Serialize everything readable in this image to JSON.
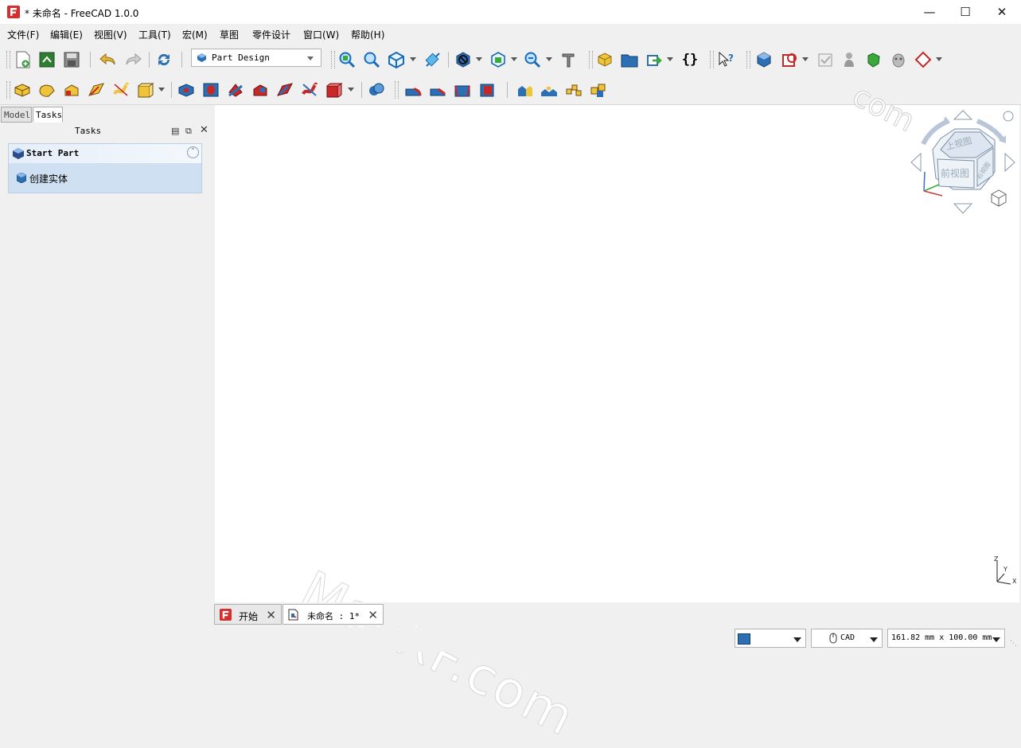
{
  "window": {
    "title": "* 未命名 - FreeCAD 1.0.0"
  },
  "menu": [
    "文件(F)",
    "编辑(E)",
    "视图(V)",
    "工具(T)",
    "宏(M)",
    "草图",
    "零件设计",
    "窗口(W)",
    "帮助(H)"
  ],
  "toolbar1": {
    "workbench": "Part Design",
    "icons": [
      "new-document-icon",
      "open-icon",
      "save-icon",
      "undo-icon",
      "redo-icon",
      "refresh-icon",
      "fit-all-icon",
      "fit-selection-icon",
      "isometric-view-icon",
      "measure-icon",
      "draw-style-icon",
      "bounding-box-icon",
      "zoom-icon",
      "measure-tool-icon",
      "create-part-icon",
      "create-group-icon",
      "link-icon",
      "variable-set-icon",
      "whats-this-icon",
      "body-icon",
      "sketch-icon",
      "check-geometry-icon",
      "attach-icon",
      "shape-binder-icon",
      "sub-shape-binder-icon",
      "datum-icon"
    ]
  },
  "toolbar2": {
    "icons": [
      "pad-icon",
      "revolution-icon",
      "additive-loft-icon",
      "additive-pipe-icon",
      "additive-helix-icon",
      "additive-primitive-icon",
      "pocket-icon",
      "hole-icon",
      "groove-icon",
      "subtractive-loft-icon",
      "subtractive-pipe-icon",
      "subtractive-helix-icon",
      "subtractive-primitive-icon",
      "boolean-icon",
      "fillet-icon",
      "chamfer-icon",
      "draft-icon",
      "thickness-icon",
      "mirrored-icon",
      "linear-pattern-icon",
      "polar-pattern-icon",
      "multi-transform-icon"
    ]
  },
  "left_panel": {
    "tabs": [
      "Model",
      "Tasks"
    ],
    "active_tab": "Tasks",
    "title": "Tasks",
    "taskbox": {
      "title": "Start Part",
      "item": "创建实体"
    }
  },
  "viewport": {
    "watermark": "MacXF.com",
    "watermark_top": "com",
    "navcube_faces": {
      "top": "上视图",
      "front": "前视图",
      "right": "右视图"
    },
    "axes": {
      "z": "Z",
      "y": "Y",
      "x": "X"
    }
  },
  "doc_tabs": [
    {
      "label": "开始",
      "active": false
    },
    {
      "label": "未命名 : 1*",
      "active": true
    }
  ],
  "statusbar": {
    "nav_style": "CAD",
    "dimensions": "161.82 mm x 100.00 mm"
  },
  "colors": {
    "accent_blue": "#2d6fb5",
    "task_bg": "#cfe0f3"
  }
}
